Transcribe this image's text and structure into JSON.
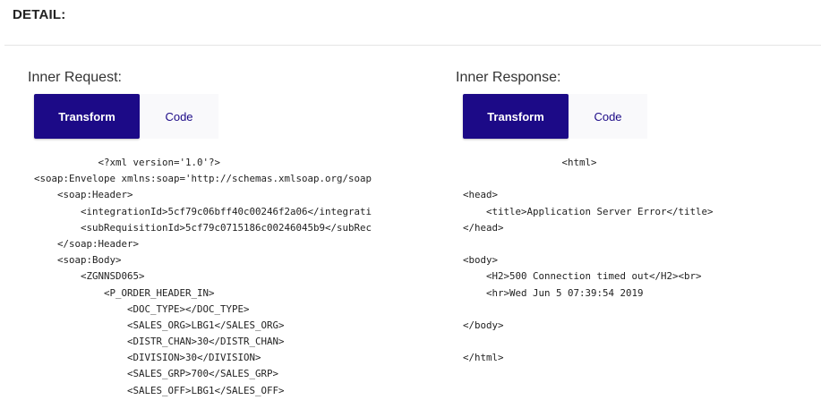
{
  "detail_heading": "DETAIL:",
  "request": {
    "title": "Inner Request:",
    "tabs": [
      {
        "label": "Transform",
        "active": true
      },
      {
        "label": "Code",
        "active": false
      }
    ],
    "code_lines": [
      "           <?xml version='1.0'?>",
      "<soap:Envelope xmlns:soap='http://schemas.xmlsoap.org/soap",
      "    <soap:Header>",
      "        <integrationId>5cf79c06bff40c00246f2a06</integrati",
      "        <subRequisitionId>5cf79c0715186c00246045b9</subRec",
      "    </soap:Header>",
      "    <soap:Body>",
      "        <ZGNNSD065>",
      "            <P_ORDER_HEADER_IN>",
      "                <DOC_TYPE></DOC_TYPE>",
      "                <SALES_ORG>LBG1</SALES_ORG>",
      "                <DISTR_CHAN>30</DISTR_CHAN>",
      "                <DIVISION>30</DIVISION>",
      "                <SALES_GRP>700</SALES_GRP>",
      "                <SALES_OFF>LBG1</SALES_OFF>"
    ]
  },
  "response": {
    "title": "Inner Response:",
    "tabs": [
      {
        "label": "Transform",
        "active": true
      },
      {
        "label": "Code",
        "active": false
      }
    ],
    "code_lines": [
      "                 <html>",
      "",
      "<head>",
      "    <title>Application Server Error</title>",
      "</head>",
      "",
      "<body>",
      "    <H2>500 Connection timed out</H2><br>",
      "    <hr>Wed Jun 5 07:39:54 2019",
      "",
      "</body>",
      "",
      "</html>"
    ]
  },
  "colors": {
    "tab_active_bg": "#1c0a87",
    "tab_inactive_text": "#1c0a87",
    "divider": "#e4e4e4"
  }
}
